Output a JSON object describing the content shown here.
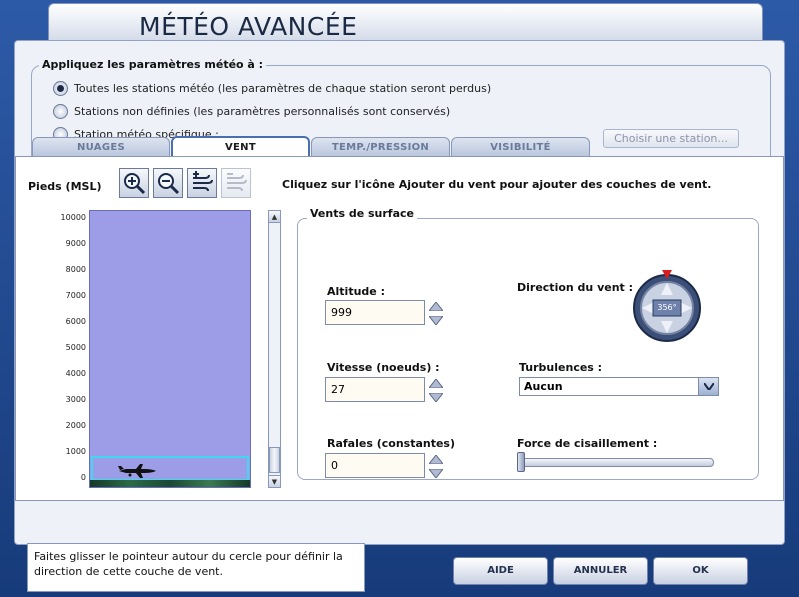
{
  "window": {
    "title": "MÉTÉO AVANCÉE"
  },
  "apply": {
    "group_label": "Appliquez les paramètres météo à :",
    "options": [
      {
        "label": "Toutes les stations météo (les paramètres de chaque station seront perdus)",
        "selected": true
      },
      {
        "label": "Stations non définies (les paramètres personnalisés sont conservés)",
        "selected": false
      },
      {
        "label": "Station météo spécifique :",
        "selected": false
      }
    ],
    "choose_station_label": "Choisir une station..."
  },
  "tabs": [
    {
      "label": "NUAGES",
      "active": false
    },
    {
      "label": "VENT",
      "active": true
    },
    {
      "label": "TEMP./PRESSION",
      "active": false
    },
    {
      "label": "VISIBILITÉ",
      "active": false
    }
  ],
  "wind": {
    "altitude_axis_label": "Pieds (MSL)",
    "toolbar": {
      "zoom_in": "zoom-in-icon",
      "zoom_out": "zoom-out-icon",
      "add_wind": "add-wind-layer-icon",
      "remove_wind": "remove-wind-layer-icon"
    },
    "hint": "Cliquez sur l'icône Ajouter du vent pour ajouter des couches de vent.",
    "axis_ticks": [
      "10000",
      "9000",
      "8000",
      "7000",
      "6000",
      "5000",
      "4000",
      "3000",
      "2000",
      "1000",
      "0"
    ],
    "surface": {
      "group_label": "Vents de surface",
      "altitude_label": "Altitude :",
      "altitude_value": "999",
      "speed_label": "Vitesse (noeuds) :",
      "speed_value": "27",
      "gusts_label": "Rafales (constantes)",
      "gusts_value": "0",
      "direction_label": "Direction du vent :",
      "direction_value": "356°",
      "turbulence_label": "Turbulences :",
      "turbulence_value": "Aucun",
      "shear_label": "Force de cisaillement :",
      "shear_level": 0
    }
  },
  "footer": {
    "note": "Faites glisser le pointeur autour du cercle pour définir la direction de cette couche de vent.",
    "help_label": "AIDE",
    "cancel_label": "ANNULER",
    "ok_label": "OK"
  },
  "colors": {
    "frame": "#1d3f7c",
    "sky": "#9c9de6",
    "layer_highlight": "#3fd7f2",
    "compass_marker": "#d81e1e"
  }
}
